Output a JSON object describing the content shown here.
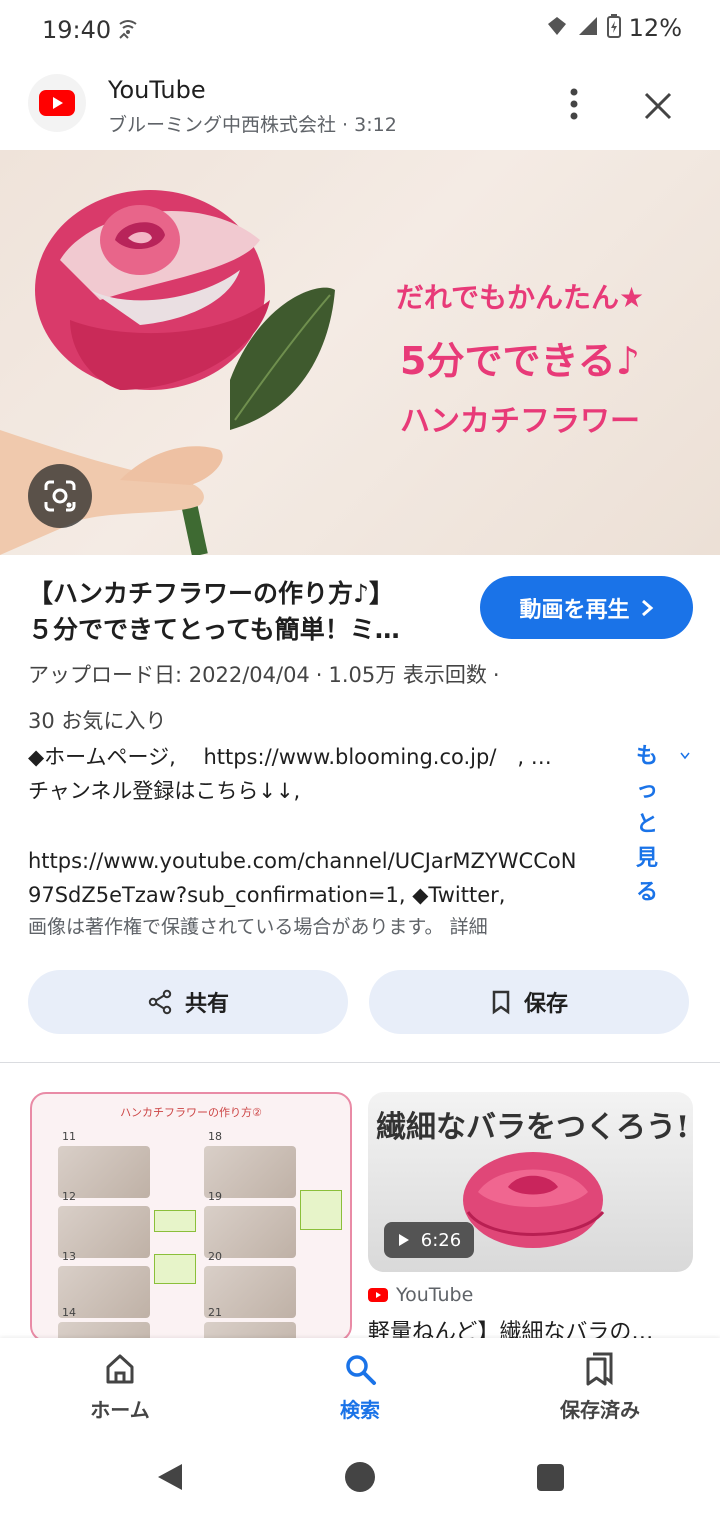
{
  "status_bar": {
    "time": "19:40",
    "battery": "12%"
  },
  "header": {
    "app_name": "YouTube",
    "subtitle": "ブルーミング中西株式会社 · 3:12"
  },
  "hero": {
    "line1": "だれでもかんたん★",
    "line2": "5分でできる♪",
    "line3": "ハンカチフラワー"
  },
  "video": {
    "title": "【ハンカチフラワーの作り方♪】５分でできてとっても簡単！ミ…",
    "title_line1": "【ハンカチフラワーの作り方♪】",
    "title_line2": "５分でできてとっても簡単！ミ…",
    "play_label": "動画を再生",
    "upload_date": "アップロード日: 2022/04/04",
    "views": "1.05万 表示回数",
    "likes": "30 お気に入り",
    "desc_line1": "◆ホームページ,　 https://www.blooming.co.jp/　, …",
    "desc_line2": "チャンネル登録はこちら↓↓,",
    "desc_line3": "https://www.youtube.com/channel/UCJarMZYWCCoN",
    "desc_line4": "97SdZ5eTzaw?sub_confirmation=1, ◆Twitter,",
    "more_label": "もっと見る",
    "copyright": "画像は著作権で保護されている場合があります。 詳細"
  },
  "actions": {
    "share": "共有",
    "save": "保存"
  },
  "related": {
    "left_title": "ハンカチフラワーの作り方②",
    "steps": [
      "11",
      "12",
      "13",
      "14",
      "18",
      "19",
      "20",
      "21"
    ],
    "right_heading": "繊細なバラをつくろう!",
    "duration": "6:26",
    "source": "YouTube",
    "right_title": "軽量ねんど】繊細なバラの…"
  },
  "bottom_nav": {
    "home": "ホーム",
    "search": "検索",
    "saved": "保存済み"
  },
  "colors": {
    "accent": "#1a73e8",
    "youtube_red": "#ff0000",
    "hero_pink": "#e83a78"
  }
}
